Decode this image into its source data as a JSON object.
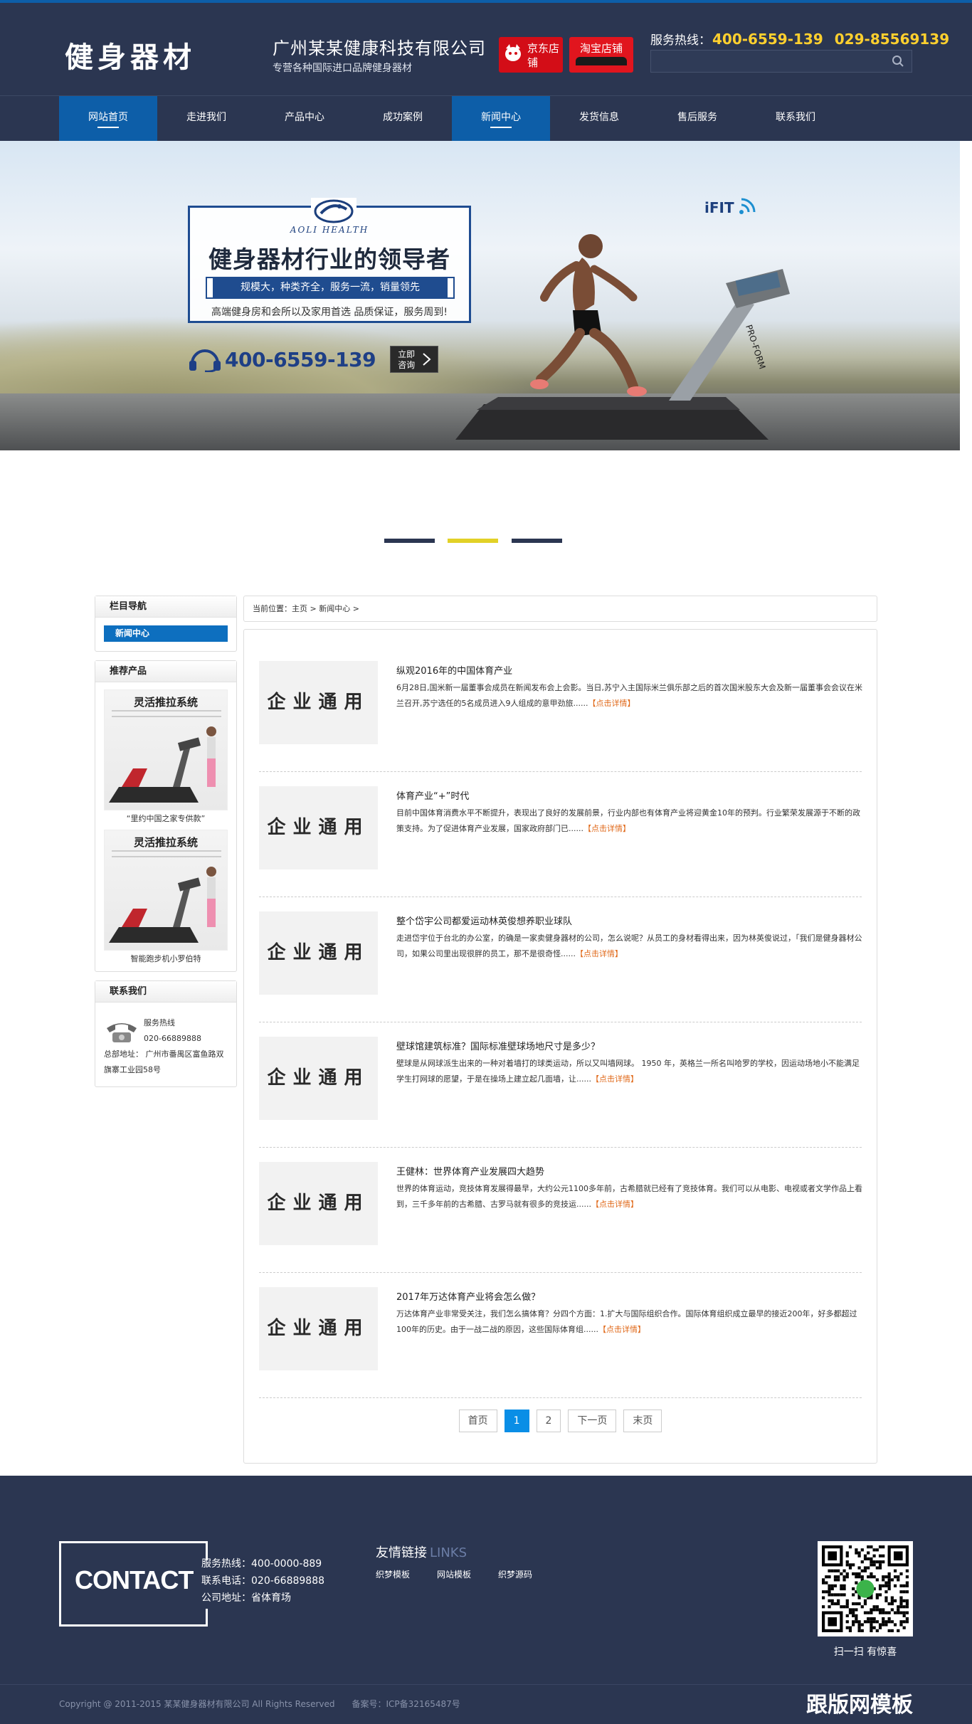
{
  "header": {
    "logo_text": "健身器材",
    "company_name": "广州某某健康科技有限公司",
    "company_slogan": "专营各种国际进口品牌健身器材",
    "shop_jd": "京东店铺",
    "shop_taobao": "淘宝店铺",
    "hotline_label": "服务热线：",
    "hotline_1": "400-6559-139",
    "hotline_2": "029-85569139",
    "search_placeholder": ""
  },
  "nav": {
    "items": [
      {
        "label": "网站首页",
        "active": true
      },
      {
        "label": "走进我们",
        "active": false
      },
      {
        "label": "产品中心",
        "active": false
      },
      {
        "label": "成功案例",
        "active": false
      },
      {
        "label": "新闻中心",
        "active": true
      },
      {
        "label": "发货信息",
        "active": false
      },
      {
        "label": "售后服务",
        "active": false
      },
      {
        "label": "联系我们",
        "active": false
      }
    ]
  },
  "banner": {
    "brand": "AOLI HEALTH",
    "title": "健身器材行业的领导者",
    "tagline": "规模大，种类齐全，服务一流，销量领先",
    "subtitle": "高端健身房和会所以及家用首选  品质保证，服务周到!",
    "phone": "400-6559-139",
    "consult_line1": "立即",
    "consult_line2": "咨询",
    "device_brand": "iFIT",
    "treadmill_brand": "PRO-FORM"
  },
  "sidebar": {
    "nav_title": "栏目导航",
    "nav_item": "新闻中心",
    "rec_title": "推荐产品",
    "products": [
      {
        "img_title": "灵活推拉系统",
        "caption": "“里约中国之家专供款”"
      },
      {
        "img_title": "灵活推拉系统",
        "caption": "智能跑步机小罗伯特"
      }
    ],
    "contact_title": "联系我们",
    "contact_hotline_label": "服务热线",
    "contact_phone": "020-66889888",
    "contact_address": "总部地址： 广州市番禺区富鱼路双旗寨工业园58号"
  },
  "breadcrumb": "当前位置：主页 > 新闻中心 >",
  "news": {
    "thumb_text": "企业通用",
    "more_label": "【点击详情】",
    "items": [
      {
        "title": "纵观2016年的中国体育产业",
        "desc": "6月28日,国米新一届董事会成员在新闻发布会上会影。当日,苏宁入主国际米兰俱乐部之后的首次国米股东大会及新一届董事会会议在米兰召开,苏宁选任的5名成员进入9人组成的意甲劲旅......"
      },
      {
        "title": "体育产业“+”时代",
        "desc": "目前中国体育消费水平不断提升，表现出了良好的发展前景，行业内部也有体育产业将迎黄金10年的预判。行业繁荣发展源于不断的政策支持。为了促进体育产业发展，国家政府部门已......"
      },
      {
        "title": "整个岱宇公司都爱运动林英俊想养职业球队",
        "desc": "走进岱宇位于台北的办公室，的确是一家卖健身器材的公司，怎么说呢？从员工的身材看得出来，因为林英俊说过，「我们是健身器材公司，如果公司里出现很胖的员工，那不是很奇怪......"
      },
      {
        "title": "壁球馆建筑标准？国际标准壁球场地尺寸是多少？",
        "desc": "壁球是从网球派生出来的一种对着墙打的球类运动，所以又叫墙网球。 1950 年，英格兰一所名叫哈罗的学校，因运动场地小不能满足学生打网球的愿望，于是在操场上建立起几面墙，让......"
      },
      {
        "title": "王健林：世界体育产业发展四大趋势",
        "desc": "世界的体育运动，竞技体育发展得最早，大约公元1100多年前，古希腊就已经有了竞技体育。我们可以从电影、电视或者文学作品上看到，三千多年前的古希腊、古罗马就有很多的竞技运......"
      },
      {
        "title": "2017年万达体育产业将会怎么做？",
        "desc": "万达体育产业非常受关注，我们怎么搞体育？分四个方面：1.扩大与国际组织合作。国际体育组织成立最早的接近200年，好多都超过100年的历史。由于一战二战的原因，这些国际体育组......"
      }
    ]
  },
  "pager": {
    "first": "首页",
    "pages": [
      "1",
      "2"
    ],
    "current": "1",
    "next": "下一页",
    "last": "末页"
  },
  "footer": {
    "contact_word": "CONTACT",
    "hotline": "服务热线：400-0000-889",
    "phone": "联系电话：020-66889888",
    "address": "公司地址：省体育场",
    "links_title": "友情链接",
    "links_title_en": "LINKS",
    "links": [
      "织梦模板",
      "网站模板",
      "织梦源码"
    ],
    "qr_caption": "扫一扫 有惊喜",
    "copyright": "Copyright @ 2011-2015 某某健身器材有限公司 All Rights Reserved",
    "icp": "备案号：ICP备32165487号",
    "watermark": "跟版网模板"
  },
  "colors": {
    "header_bg": "#2b3651",
    "nav_active": "#0d5ea8",
    "hotline": "#ffd02e",
    "accent_blue": "#0a8ee6",
    "more_link": "#e06a1b",
    "dot_yellow": "#e2d127"
  }
}
